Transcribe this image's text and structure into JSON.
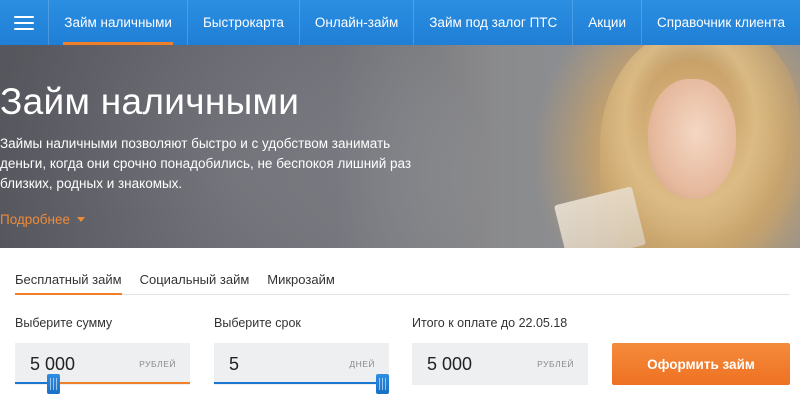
{
  "nav": {
    "menu_icon": "hamburger-icon",
    "items": [
      {
        "label": "Займ наличными",
        "active": true
      },
      {
        "label": "Быстрокарта"
      },
      {
        "label": "Онлайн-займ"
      },
      {
        "label": "Займ под залог ПТС"
      },
      {
        "label": "Акции"
      },
      {
        "label": "Справочник клиента"
      }
    ]
  },
  "hero": {
    "title": "Займ наличными",
    "description": "Займы наличными позволяют быстро и с удобством занимать деньги, когда они срочно понадобились, не беспокоя лишний раз близких, родных и знакомых.",
    "more_link": "Подробнее"
  },
  "tabs": [
    {
      "label": "Бесплатный займ",
      "active": true
    },
    {
      "label": "Социальный займ"
    },
    {
      "label": "Микрозайм"
    }
  ],
  "calculator": {
    "amount": {
      "label": "Выберите сумму",
      "value": "5 000",
      "unit": "рублей",
      "slider_fraction": 0.2
    },
    "term": {
      "label": "Выберите срок",
      "value": "5",
      "unit": "дней",
      "slider_fraction": 1.0
    },
    "total": {
      "label": "Итого к оплате до 22.05.18",
      "value": "5 000",
      "unit": "рублей"
    },
    "submit_label": "Оформить займ"
  },
  "colors": {
    "nav_blue": "#1f7fd6",
    "accent_orange": "#f07f2a",
    "slider_blue": "#1a78d0",
    "field_bg": "#eeeff1"
  }
}
